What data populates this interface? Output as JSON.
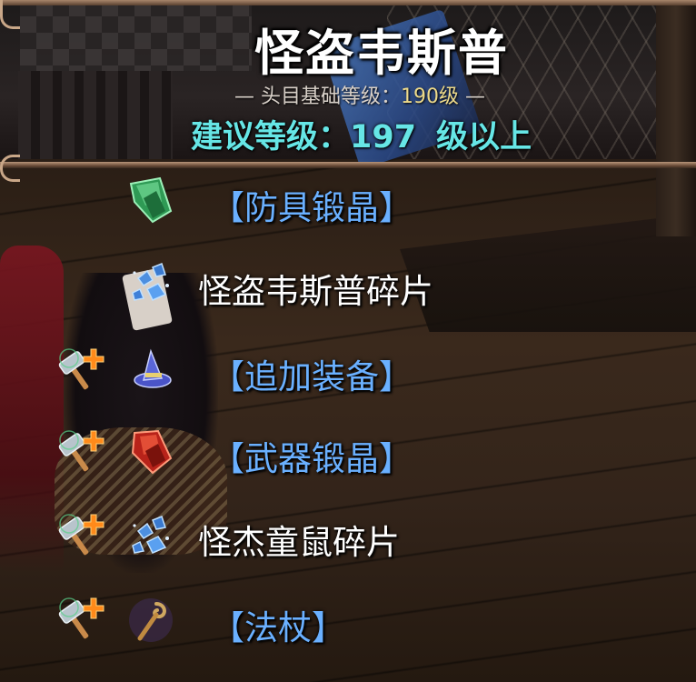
{
  "header": {
    "boss_name": "怪盗韦斯普",
    "base_level_prefix": "— 头目基础等级：",
    "base_level_value": "190级",
    "base_level_suffix": " —",
    "recommended_label": "建议等级：",
    "recommended_value": "197",
    "recommended_suffix": "级以上"
  },
  "drops": [
    {
      "name": "【防具锻晶】",
      "icon": "green-crystal-icon",
      "upgrade": false,
      "style": "bracket"
    },
    {
      "name": "怪盗韦斯普碎片",
      "icon": "blue-fragments-icon",
      "upgrade": false,
      "style": "plain"
    },
    {
      "name": "【追加装备】",
      "icon": "wizard-hat-icon",
      "upgrade": true,
      "style": "bracket"
    },
    {
      "name": "【武器锻晶】",
      "icon": "red-crystal-icon",
      "upgrade": true,
      "style": "bracket"
    },
    {
      "name": "怪杰童鼠碎片",
      "icon": "blue-fragments-icon",
      "upgrade": true,
      "style": "plain"
    },
    {
      "name": "【法杖】",
      "icon": "staff-icon",
      "upgrade": true,
      "style": "bracket"
    }
  ],
  "colors": {
    "bracket_text": "#6ab0ff",
    "recommended_text": "#66e6e6",
    "level_value": "#ecd98a"
  }
}
